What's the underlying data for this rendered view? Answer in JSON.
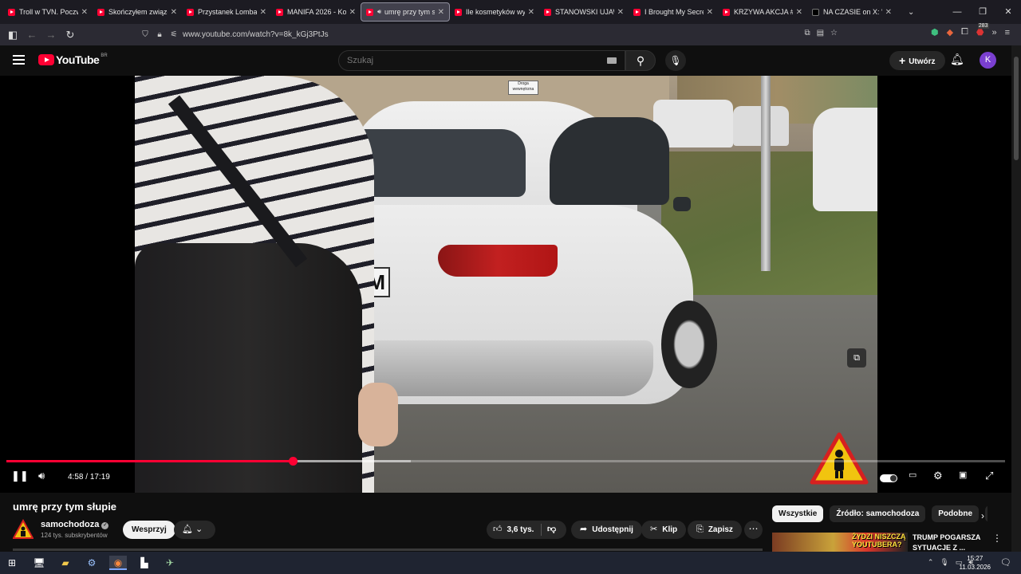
{
  "browser": {
    "tabs": [
      {
        "title": "Troll w TVN. Poczwór",
        "icon": "youtube-favicon"
      },
      {
        "title": "Skończyłem związek,",
        "icon": "youtube-favicon"
      },
      {
        "title": "Przystanek Lombard",
        "icon": "youtube-favicon"
      },
      {
        "title": "MANIFA 2026 - Kobi",
        "icon": "youtube-favicon"
      },
      {
        "title": "umrę przy tym sł",
        "icon": "youtube-favicon",
        "active": true,
        "audio": true
      },
      {
        "title": "Ile kosmetyków wyst",
        "icon": "youtube-favicon"
      },
      {
        "title": "STANOWSKI UJAWNI",
        "icon": "youtube-favicon"
      },
      {
        "title": "I Brought My Secret",
        "icon": "youtube-favicon"
      },
      {
        "title": "KRZYWA AKCJA #9 -",
        "icon": "youtube-favicon"
      },
      {
        "title": "NA CZASIE on X: \"",
        "icon": "x-favicon"
      }
    ],
    "url": "www.youtube.com/watch?v=8k_kGj3PtJs",
    "extension_badge": "283"
  },
  "youtube": {
    "logo_text": "YouTube",
    "logo_region": "BR",
    "search_placeholder": "Szukaj",
    "create_label": "Utwórz",
    "avatar_letter": "K",
    "accent": "#ff0033"
  },
  "player": {
    "plate_text": "M",
    "car_sign": "Droga wewnętrzna",
    "time_current": "4:58",
    "time_sep": " / ",
    "time_total": "17:19",
    "progress_fraction": 0.287,
    "buffered_fraction": 0.405
  },
  "video": {
    "title": "umrę przy tym słupie",
    "channel_name": "samochodoza",
    "subscribers": "124 tys. subskrybentów",
    "support_label": "Wesprzyj",
    "likes": "3,6 tys.",
    "share_label": "Udostępnij",
    "clip_label": "Klip",
    "save_label": "Zapisz"
  },
  "sidebar": {
    "chips": [
      "Wszystkie",
      "Źródło: samochodoza",
      "Podobne",
      "D"
    ],
    "related": {
      "title": "TRUMP POGARSZA SYTUACJE Z ...",
      "thumb_text": "ŻYDZI NISZCZĄ YOUTUBERA?"
    }
  },
  "taskbar": {
    "time": "15:27",
    "date": "11.03.2026"
  }
}
